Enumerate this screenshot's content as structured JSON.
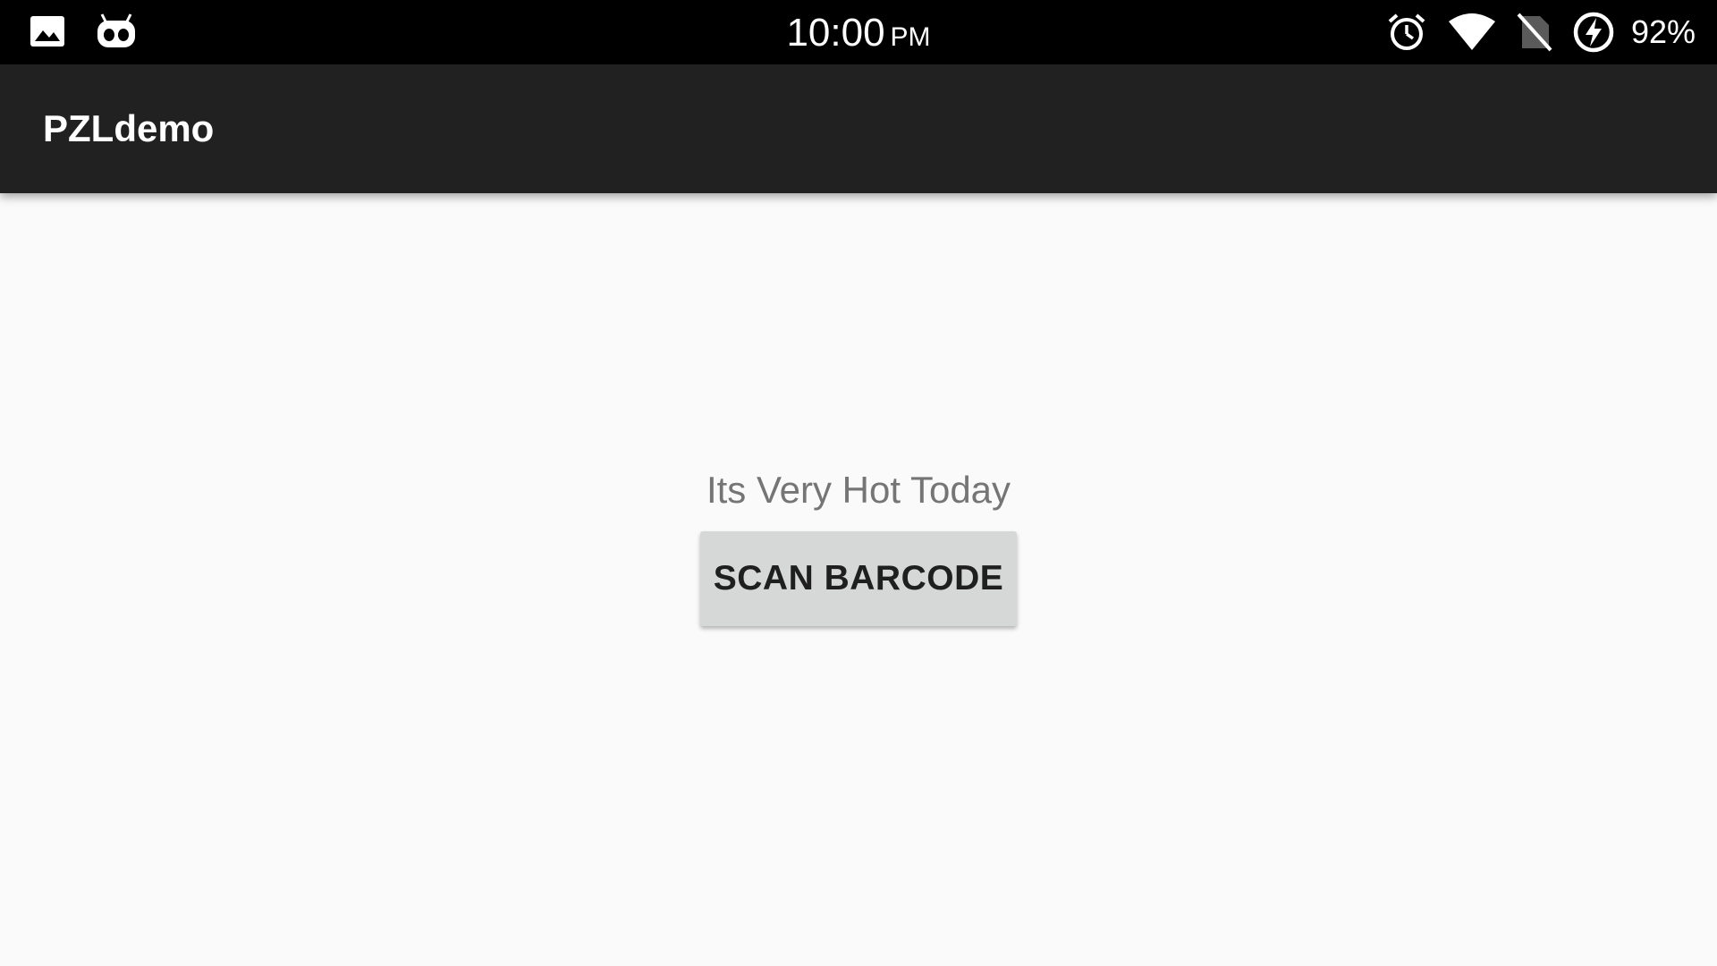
{
  "status_bar": {
    "time": "10:00",
    "ampm": "PM",
    "battery_percent": "92%",
    "left_icons": [
      "image-icon",
      "cyanogen-mascot-icon"
    ],
    "right_icons": [
      "alarm-icon",
      "wifi-icon",
      "no-sim-icon",
      "battery-charging-icon"
    ]
  },
  "app_bar": {
    "title": "PZLdemo",
    "background_color": "#212121"
  },
  "main": {
    "message": "Its Very Hot Today",
    "scan_button_label": "SCAN BARCODE"
  }
}
